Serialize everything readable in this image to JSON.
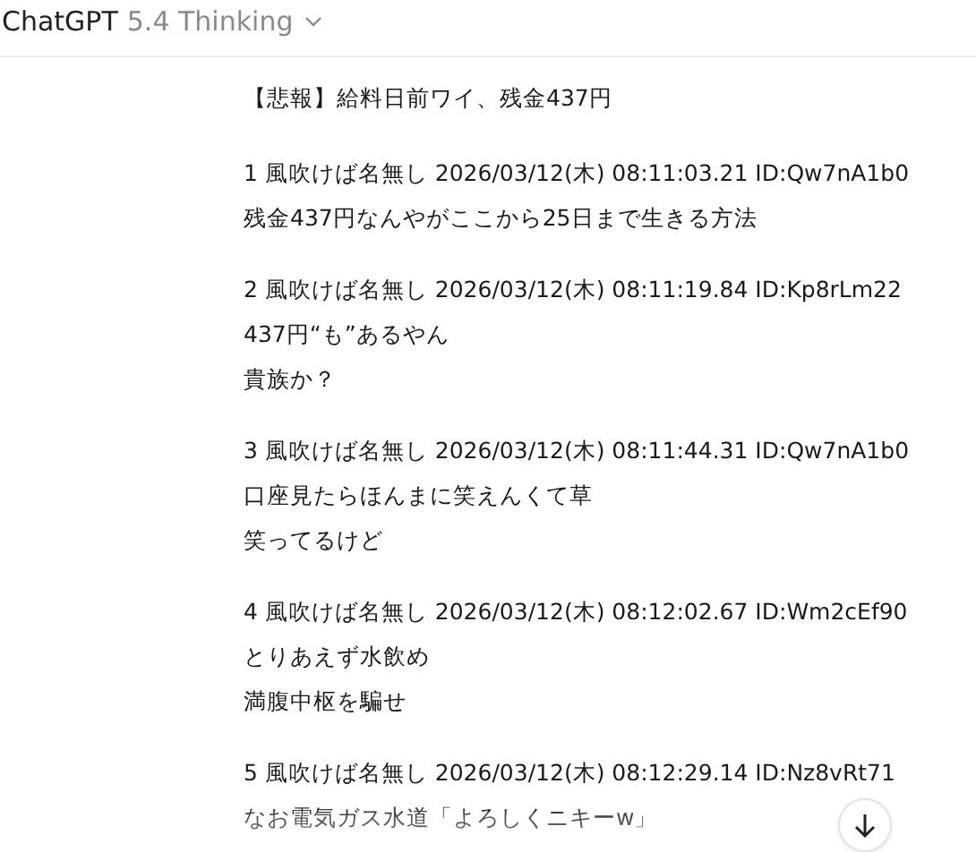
{
  "header": {
    "app_name": "ChatGPT",
    "model": "5.4 Thinking"
  },
  "thread": {
    "title": "【悲報】給料日前ワイ、残金437円",
    "posts": [
      {
        "header": "1 風吹けば名無し 2026/03/12(木) 08:11:03.21 ID:Qw7nA1b0",
        "lines": [
          "残金437円なんやがここから25日まで生きる方法"
        ]
      },
      {
        "header": "2 風吹けば名無し 2026/03/12(木) 08:11:19.84 ID:Kp8rLm22",
        "lines": [
          "437円“も”あるやん",
          "貴族か？"
        ]
      },
      {
        "header": "3 風吹けば名無し 2026/03/12(木) 08:11:44.31 ID:Qw7nA1b0",
        "lines": [
          "口座見たらほんまに笑えんくて草",
          "笑ってるけど"
        ]
      },
      {
        "header": "4 風吹けば名無し 2026/03/12(木) 08:12:02.67 ID:Wm2cEf90",
        "lines": [
          "とりあえず水飲め",
          "満腹中枢を騙せ"
        ]
      },
      {
        "header": "5 風吹けば名無し 2026/03/12(木) 08:12:29.14 ID:Nz8vRt71",
        "lines": [
          "なお電気ガス水道「よろしくニキーw」"
        ]
      }
    ]
  }
}
